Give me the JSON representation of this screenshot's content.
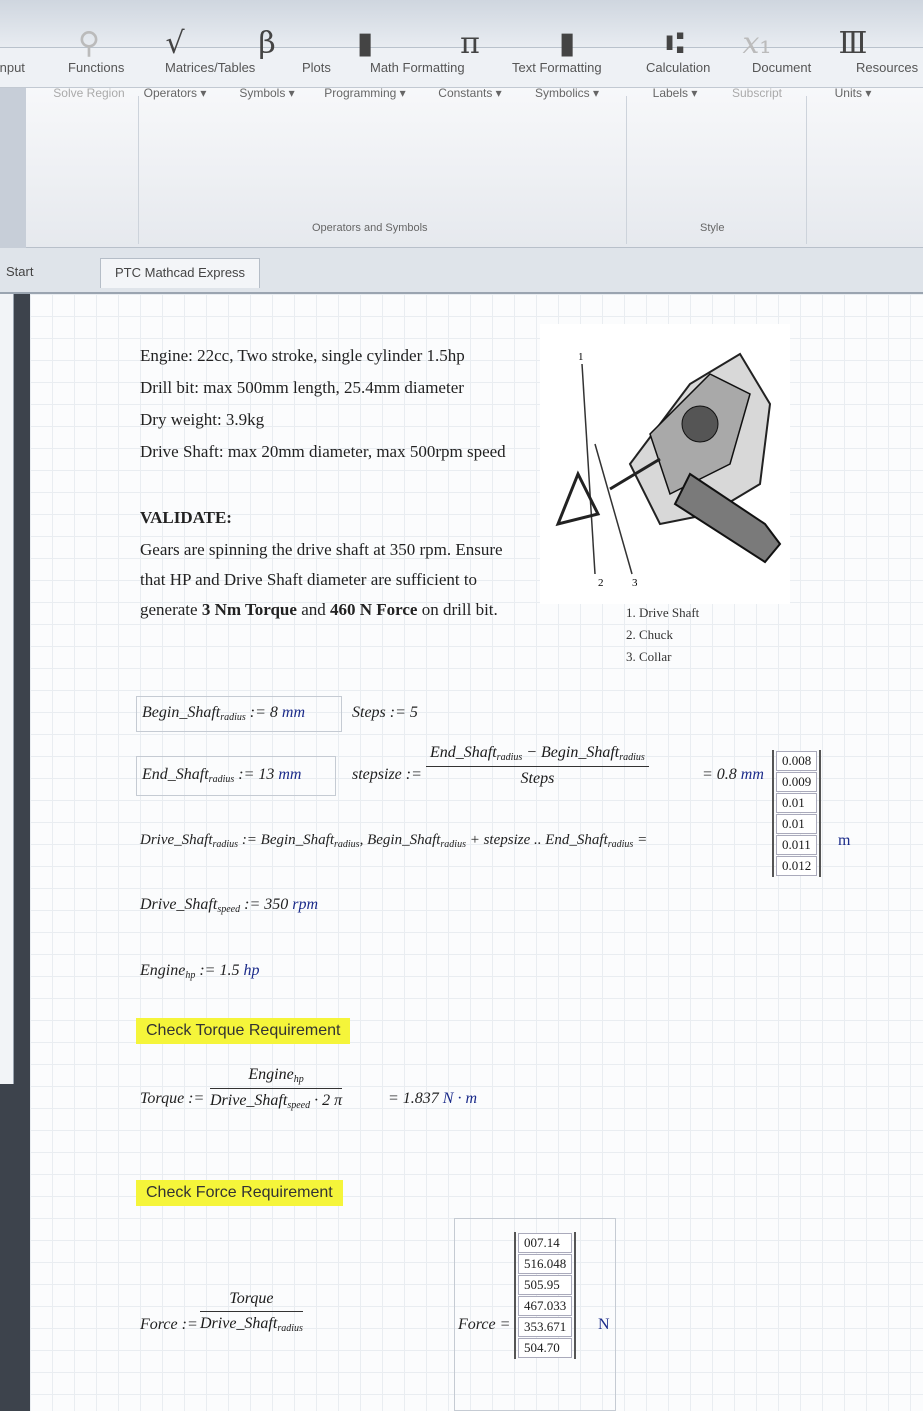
{
  "menu": {
    "tabs": [
      "Input",
      "Functions",
      "Matrices/Tables",
      "Plots",
      "Math Formatting",
      "Text Formatting",
      "Calculation",
      "Document",
      "Resources"
    ]
  },
  "ribbon": {
    "items": [
      {
        "glyph": "⚲",
        "label": "Solve Region",
        "dim": true
      },
      {
        "glyph": "√",
        "label": "Operators ▾"
      },
      {
        "glyph": "β",
        "label": "Symbols ▾"
      },
      {
        "glyph": "▮",
        "label": "Programming ▾"
      },
      {
        "glyph": "π",
        "label": "Constants ▾"
      },
      {
        "glyph": "▮",
        "label": "Symbolics ▾"
      },
      {
        "glyph": "⑆",
        "label": "Labels ▾"
      },
      {
        "glyph": "𝑥₁",
        "label": "Subscript",
        "dim": true
      },
      {
        "glyph": "Ⅲ",
        "label": "Units ▾"
      }
    ],
    "group_operators": "Operators and Symbols",
    "group_style": "Style"
  },
  "doc_tabs": [
    "Start",
    "PTC Mathcad Express"
  ],
  "sheet": {
    "spec_lines": [
      "Engine: 22cc, Two stroke, single cylinder 1.5hp",
      "Drill bit: max 500mm length, 25.4mm diameter",
      "Dry weight: 3.9kg",
      "Drive Shaft: max 20mm diameter, max 500rpm speed"
    ],
    "validate_heading": "VALIDATE:",
    "validate_lines": [
      "Gears are spinning the drive shaft at 350 rpm. Ensure",
      "that HP and Drive Shaft diameter are sufficient to"
    ],
    "validate_last": {
      "pre": "generate ",
      "torque": "3 Nm Torque",
      "mid": " and ",
      "force": "460 N Force",
      "post": " on drill bit."
    },
    "legend": [
      "1.  Drive Shaft",
      "2.  Chuck",
      "3.  Collar"
    ],
    "eq": {
      "begin_name": "Begin_Shaft",
      "begin_sub": "radius",
      "begin_val": " := 8 ",
      "begin_unit": "mm",
      "steps": "Steps := 5",
      "end_name": "End_Shaft",
      "end_sub": "radius",
      "end_val": " := 13 ",
      "end_unit": "mm",
      "stepsize_lhs": "stepsize :=",
      "stepsize_num": "End_Shaft",
      "stepsize_num_sub": "radius",
      "stepsize_num_mid": " − Begin_Shaft",
      "stepsize_num_sub2": "radius",
      "stepsize_den": "Steps",
      "stepsize_res": "= 0.8 ",
      "stepsize_unit": "mm",
      "drive_line": "Drive_Shaft",
      "drive_sub": "radius",
      "drive_rhs": " := Begin_Shaft",
      "drive_rhs2": ", Begin_Shaft",
      "drive_rhs3": " + stepsize .. End_Shaft",
      "drive_rhs_end": " =",
      "drive_matrix": [
        "0.008",
        "0.009",
        "0.01",
        "0.01",
        "0.011",
        "0.012"
      ],
      "drive_unit": "m",
      "speed_name": "Drive_Shaft",
      "speed_sub": "speed",
      "speed_val": " := 350 ",
      "speed_unit": "rpm",
      "engine_name": "Engine",
      "engine_sub": "hp",
      "engine_val": " := 1.5 ",
      "engine_unit": "hp",
      "check_torque": "Check Torque Requirement",
      "torque_lhs": "Torque :=",
      "torque_num": "Engine",
      "torque_num_sub": "hp",
      "torque_den": "Drive_Shaft",
      "torque_den_sub": "speed",
      "torque_den_post": " · 2 π",
      "torque_res": "= 1.837 ",
      "torque_unit": "N · m",
      "check_force": "Check Force Requirement",
      "force_lhs": "Force :=",
      "force_num": "Torque",
      "force_den": "Drive_Shaft",
      "force_den_sub": "radius",
      "force_res_lhs": "Force =",
      "force_matrix": [
        "007.14",
        "516.048",
        "505.95",
        "467.033",
        "353.671",
        "504.70"
      ],
      "force_unit": "N"
    }
  }
}
